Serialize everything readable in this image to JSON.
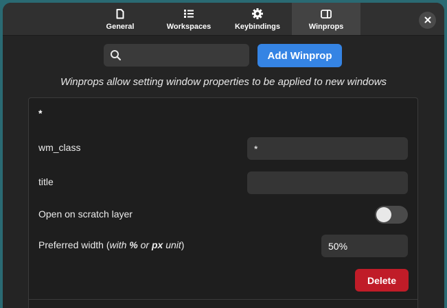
{
  "tabs": [
    {
      "label": "General",
      "icon": "document-icon"
    },
    {
      "label": "Workspaces",
      "icon": "list-icon"
    },
    {
      "label": "Keybindings",
      "icon": "gear-icon"
    },
    {
      "label": "Winprops",
      "icon": "window-icon",
      "active": true
    }
  ],
  "search": {
    "value": "",
    "placeholder": ""
  },
  "add_button_label": "Add Winprop",
  "description": "Winprops allow setting window properties to be applied to new windows",
  "winprop": {
    "title": "*",
    "wm_class_label": "wm_class",
    "wm_class_value": "*",
    "title_label": "title",
    "title_value": "",
    "scratch_label": "Open on scratch layer",
    "scratch_enabled": false,
    "width_label_prefix": "Preferred width (",
    "width_label_with": "with ",
    "width_label_pct": "%",
    "width_label_or": " or ",
    "width_label_px": "px",
    "width_label_unit": " unit",
    "width_label_suffix": ")",
    "width_value": "50%",
    "delete_label": "Delete"
  },
  "colors": {
    "accent": "#3584e4",
    "destructive": "#c01c28",
    "background": "#242424"
  }
}
